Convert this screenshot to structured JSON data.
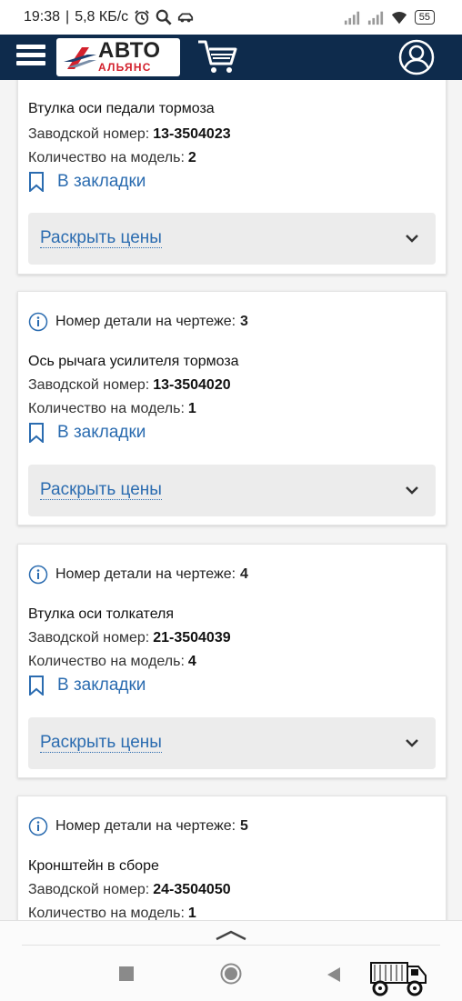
{
  "status_bar": {
    "time": "19:38",
    "speed": "5,8 КБ/с",
    "battery": "55"
  },
  "header": {
    "logo_line1": "АВТО",
    "logo_line2": "АЛЬЯНС",
    "icons": [
      "menu-icon",
      "cart-icon",
      "user-icon"
    ]
  },
  "labels": {
    "drawing_number": "Номер детали на чертеже:",
    "factory_number": "Заводской номер:",
    "qty_per_model": "Количество на модель:",
    "bookmark": "В закладки",
    "show_prices": "Раскрыть цены"
  },
  "parts": [
    {
      "drawing_no": "",
      "name": "Втулка оси педали тормоза",
      "factory_no": "13-3504023",
      "qty": "2"
    },
    {
      "drawing_no": "3",
      "name": "Ось рычага усилителя тормоза",
      "factory_no": "13-3504020",
      "qty": "1"
    },
    {
      "drawing_no": "4",
      "name": "Втулка оси толкателя",
      "factory_no": "21-3504039",
      "qty": "4"
    },
    {
      "drawing_no": "5",
      "name": "Кронштейн в сборе",
      "factory_no": "24-3504050",
      "qty": "1"
    }
  ],
  "colors": {
    "header_bg": "#0e2b4c",
    "link": "#2b6cb0",
    "logo_red": "#d3212d"
  }
}
